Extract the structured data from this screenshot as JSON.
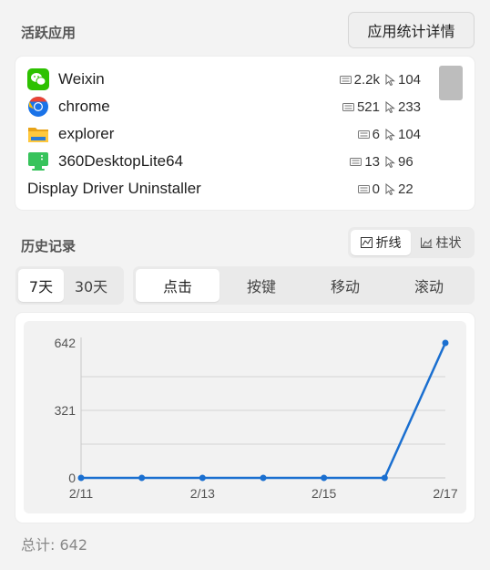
{
  "active_apps": {
    "title": "活跃应用",
    "details_button": "应用统计详情",
    "apps": [
      {
        "name": "Weixin",
        "icon": "weixin-icon",
        "keys": "2.2k",
        "clicks": "104"
      },
      {
        "name": "chrome",
        "icon": "chrome-icon",
        "keys": "521",
        "clicks": "233"
      },
      {
        "name": "explorer",
        "icon": "folder-icon",
        "keys": "6",
        "clicks": "104"
      },
      {
        "name": "360DesktopLite64",
        "icon": "desktop-icon",
        "keys": "13",
        "clicks": "96"
      },
      {
        "name": "Display Driver Uninstaller",
        "icon": "",
        "keys": "0",
        "clicks": "22"
      }
    ]
  },
  "history": {
    "title": "历史记录",
    "chart_type_toggle": {
      "line": "折线",
      "bar": "柱状",
      "selected": "line"
    },
    "range_tabs": [
      {
        "label": "7天",
        "active": true
      },
      {
        "label": "30天",
        "active": false
      }
    ],
    "metric_tabs": [
      {
        "label": "点击",
        "active": true
      },
      {
        "label": "按键",
        "active": false
      },
      {
        "label": "移动",
        "active": false
      },
      {
        "label": "滚动",
        "active": false
      }
    ],
    "total": "总计: 642"
  },
  "colors": {
    "line": "#1a6fd0",
    "grid": "#d4d4d4",
    "weixin": "#2dc100",
    "chrome_blue": "#1a73e8"
  },
  "chart_data": {
    "type": "line",
    "x": [
      "2/11",
      "2/12",
      "2/13",
      "2/14",
      "2/15",
      "2/16",
      "2/17"
    ],
    "series": [
      {
        "values": [
          0,
          0,
          0,
          0,
          0,
          0,
          642
        ]
      }
    ],
    "x_tick_labels": [
      "2/11",
      "2/13",
      "2/15",
      "2/17"
    ],
    "y_tick_labels": [
      "0",
      "321",
      "642"
    ],
    "ylim": [
      0,
      642
    ],
    "grid": true
  }
}
